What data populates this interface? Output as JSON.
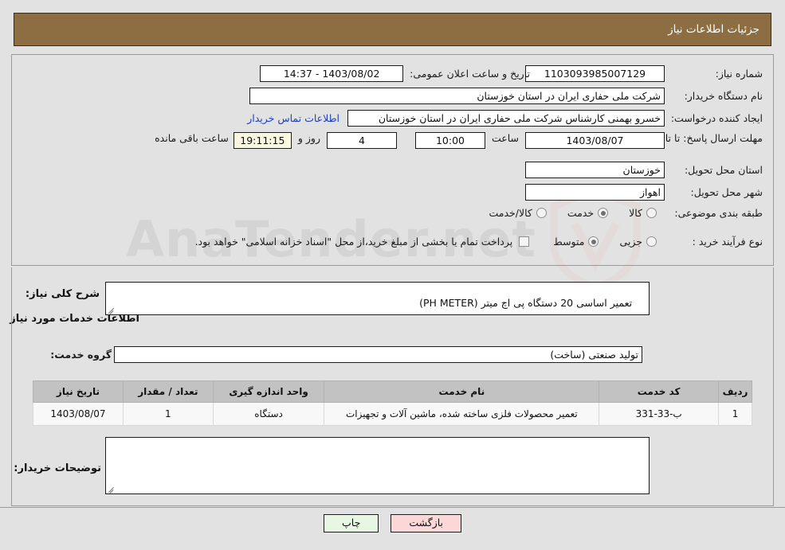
{
  "header": {
    "title": "جزئیات اطلاعات نیاز"
  },
  "watermark": {
    "text": "AnaTender.net"
  },
  "top_panel": {
    "need_number": {
      "label": "شماره نیاز:",
      "value": "1103093985007129"
    },
    "announce_datetime": {
      "label": "تاریخ و ساعت اعلان عمومی:",
      "value": "1403/08/02 - 14:37"
    },
    "buyer_org": {
      "label": "نام دستگاه خریدار:",
      "value": "شرکت ملی حفاری ایران در استان خوزستان"
    },
    "request_creator": {
      "label": "ایجاد کننده درخواست:",
      "value": "خسرو بهمنی کارشناس  شرکت ملی حفاری ایران در استان خوزستان"
    },
    "contact_link": {
      "label": "اطلاعات تماس خریدار"
    },
    "deadline": {
      "label": "مهلت ارسال پاسخ: تا تاریخ:",
      "date": "1403/08/07",
      "time_label": "ساعت",
      "time": "10:00",
      "days": "4",
      "days_suffix": "روز و",
      "countdown": "19:11:15",
      "countdown_suffix": "ساعت باقی مانده"
    },
    "province": {
      "label": "استان محل تحویل:",
      "value": "خوزستان"
    },
    "city": {
      "label": "شهر محل تحویل:",
      "value": "اهواز"
    },
    "category": {
      "label": "طبقه بندی موضوعی:",
      "options": [
        {
          "label": "کالا",
          "selected": false
        },
        {
          "label": "خدمت",
          "selected": true
        },
        {
          "label": "کالا/خدمت",
          "selected": false
        }
      ]
    },
    "purchase_type": {
      "label": "نوع فرآیند خرید :",
      "options": [
        {
          "label": "جزیی",
          "selected": false
        },
        {
          "label": "متوسط",
          "selected": true
        }
      ],
      "treasury_note": "پرداخت تمام یا بخشی از مبلغ خرید،از محل \"اسناد خزانه اسلامی\" خواهد بود.",
      "treasury_checked": false
    }
  },
  "mid_panel": {
    "general_desc": {
      "label": "شرح کلی نیاز:",
      "value": "تعمیر اساسی 20 دستگاه پی اچ میتر (PH METER)"
    },
    "services_heading": "اطلاعات خدمات مورد نیاز",
    "service_group": {
      "label": "گروه خدمت:",
      "value": "تولید صنعتی (ساخت)"
    },
    "buyer_notes": {
      "label": "توضیحات خریدار:",
      "value": ""
    }
  },
  "items_table": {
    "columns": [
      "ردیف",
      "کد خدمت",
      "نام خدمت",
      "واحد اندازه گیری",
      "تعداد / مقدار",
      "تاریخ نیاز"
    ],
    "rows": [
      {
        "index": "1",
        "code": "ب-33-331",
        "name": "تعمیر محصولات فلزی ساخته شده، ماشین آلات و تجهیزات",
        "unit": "دستگاه",
        "quantity": "1",
        "need_date": "1403/08/07"
      }
    ]
  },
  "footer": {
    "back_label": "بازگشت",
    "print_label": "چاپ"
  },
  "colors": {
    "header_brown": "#8d6e42",
    "page_bg": "#e2e2e2",
    "link_blue": "#1a3fbf",
    "table_header": "#c2c2c2",
    "back_btn": "#fbd7d7",
    "print_btn": "#e7f7e3"
  }
}
